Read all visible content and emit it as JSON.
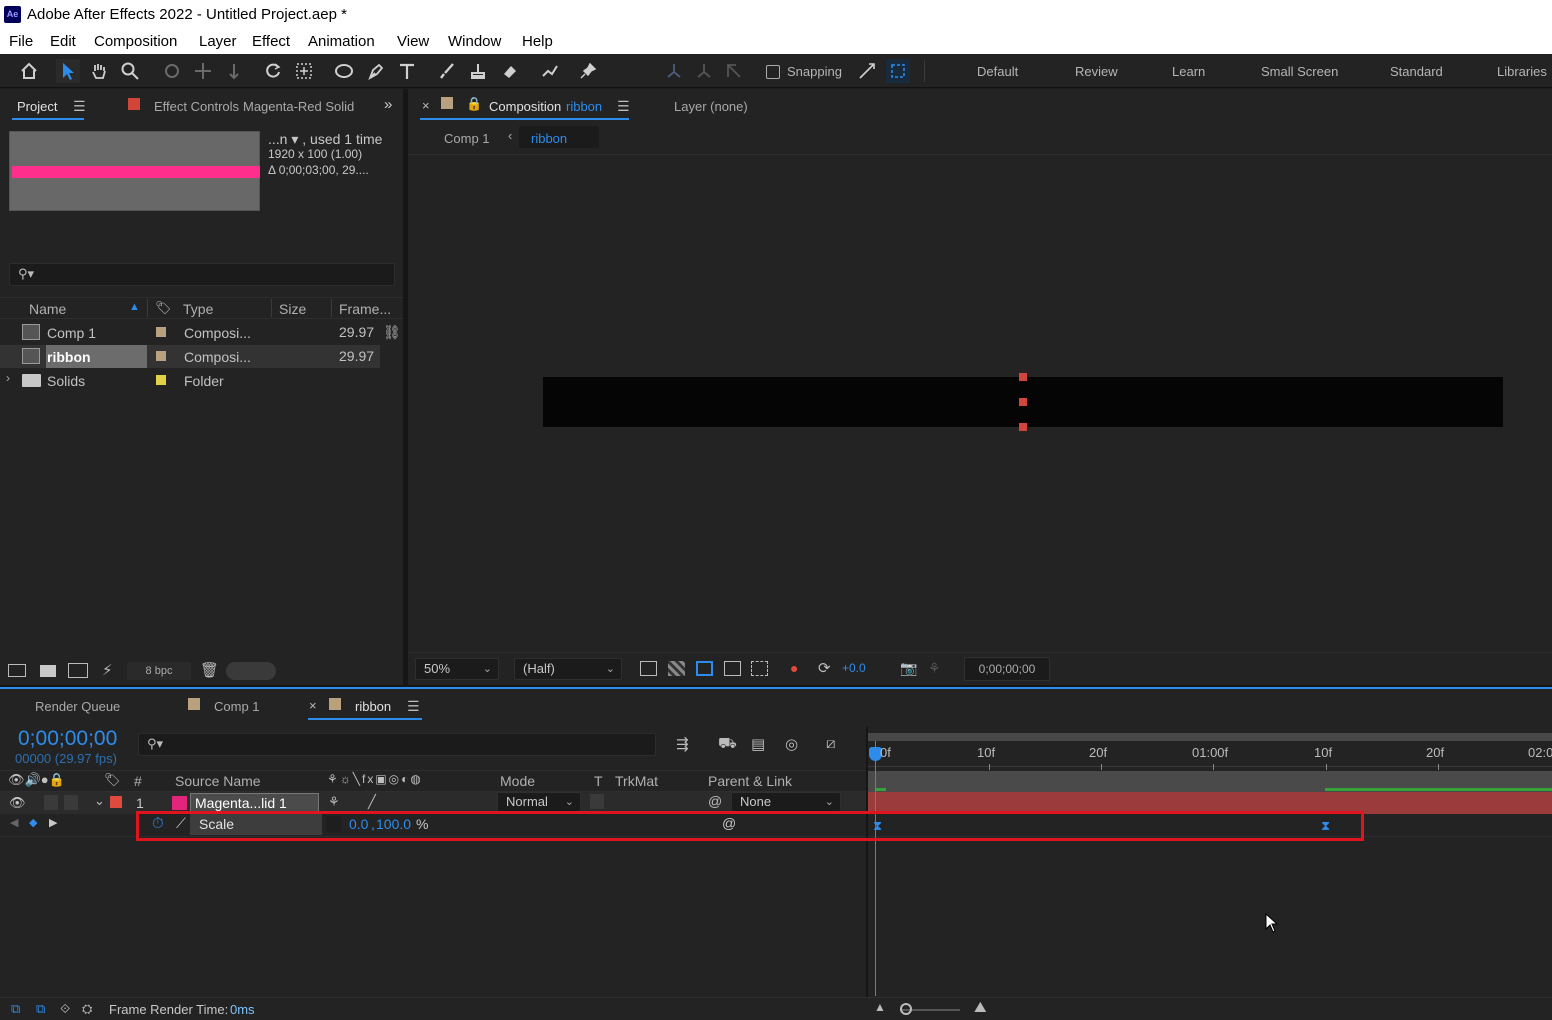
{
  "window": {
    "app_logo": "Ae",
    "title": "Adobe After Effects 2022 - Untitled Project.aep *"
  },
  "menu": [
    "File",
    "Edit",
    "Composition",
    "Layer",
    "Effect",
    "Animation",
    "View",
    "Window",
    "Help"
  ],
  "toolbar": {
    "snapping_label": "Snapping",
    "workspaces": [
      "Default",
      "Review",
      "Learn",
      "Small Screen",
      "Standard",
      "Libraries"
    ]
  },
  "project_panel": {
    "tab_label": "Project",
    "effect_controls_label": "Effect Controls",
    "effect_controls_target": "Magenta-Red Solid",
    "preview_info": {
      "name_line": "...n ▾ , used 1 time",
      "dimensions": "1920 x 100 (1.00)",
      "duration": "Δ 0;00;03;00, 29...."
    },
    "search_placeholder": "",
    "columns": [
      "Name",
      "Type",
      "Size",
      "Frame..."
    ],
    "items": [
      {
        "name": "Comp 1",
        "type": "Composi...",
        "size": "",
        "frame": "29.97",
        "label_color": "#b9a180"
      },
      {
        "name": "ribbon",
        "type": "Composi...",
        "size": "",
        "frame": "29.97",
        "label_color": "#b9a180"
      },
      {
        "name": "Solids",
        "type": "Folder",
        "size": "",
        "frame": "",
        "label_color": "#e2d046"
      }
    ],
    "bpc_label": "8 bpc"
  },
  "composition_panel": {
    "tab_prefix": "Composition",
    "tab_comp_name": "ribbon",
    "layer_tab": "Layer (none)",
    "breadcrumbs": [
      "Comp 1",
      "ribbon"
    ],
    "zoom": "50%",
    "resolution": "(Half)",
    "exposure": "+0.0",
    "timecode": "0;00;00;00"
  },
  "timeline_panel": {
    "tabs": [
      "Render Queue",
      "Comp 1",
      "ribbon"
    ],
    "current_time": "0;00;00;00",
    "frame_info": "00000 (29.97 fps)",
    "search_placeholder": "",
    "columns": {
      "num": "#",
      "source": "Source Name",
      "mode": "Mode",
      "t": "T",
      "trkmat": "TrkMat",
      "parent": "Parent & Link"
    },
    "layer": {
      "index": "1",
      "name": "Magenta...lid 1",
      "mode": "Normal",
      "parent": "None",
      "label_color": "#e04a3e",
      "source_color": "#e0257a"
    },
    "property": {
      "name": "Scale",
      "value_x": "0.0",
      "value_y": "100.0",
      "unit": "%"
    },
    "ruler_labels": [
      "0f",
      "10f",
      "20f",
      "01:00f",
      "10f",
      "20f",
      "02:0"
    ],
    "status": {
      "label": "Frame Render Time:",
      "value": "0ms"
    }
  },
  "colors": {
    "accent": "#2d8ceb",
    "highlight_box": "#e0141e",
    "layer_bar": "#a23b3b",
    "magenta": "#ff2d8c"
  }
}
